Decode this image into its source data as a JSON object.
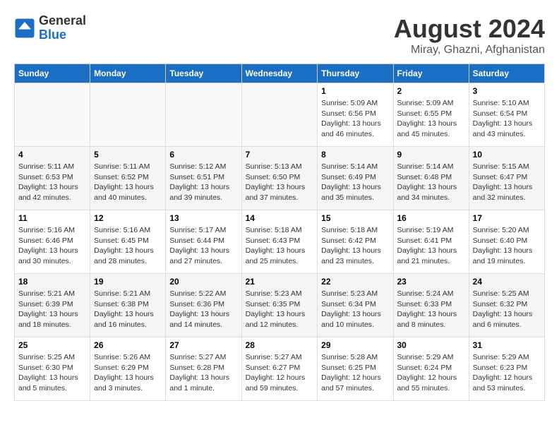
{
  "logo": {
    "general": "General",
    "blue": "Blue"
  },
  "title": "August 2024",
  "location": "Miray, Ghazni, Afghanistan",
  "days_of_week": [
    "Sunday",
    "Monday",
    "Tuesday",
    "Wednesday",
    "Thursday",
    "Friday",
    "Saturday"
  ],
  "weeks": [
    [
      {
        "date": "",
        "info": ""
      },
      {
        "date": "",
        "info": ""
      },
      {
        "date": "",
        "info": ""
      },
      {
        "date": "",
        "info": ""
      },
      {
        "date": "1",
        "info": "Sunrise: 5:09 AM\nSunset: 6:56 PM\nDaylight: 13 hours and 46 minutes."
      },
      {
        "date": "2",
        "info": "Sunrise: 5:09 AM\nSunset: 6:55 PM\nDaylight: 13 hours and 45 minutes."
      },
      {
        "date": "3",
        "info": "Sunrise: 5:10 AM\nSunset: 6:54 PM\nDaylight: 13 hours and 43 minutes."
      }
    ],
    [
      {
        "date": "4",
        "info": "Sunrise: 5:11 AM\nSunset: 6:53 PM\nDaylight: 13 hours and 42 minutes."
      },
      {
        "date": "5",
        "info": "Sunrise: 5:11 AM\nSunset: 6:52 PM\nDaylight: 13 hours and 40 minutes."
      },
      {
        "date": "6",
        "info": "Sunrise: 5:12 AM\nSunset: 6:51 PM\nDaylight: 13 hours and 39 minutes."
      },
      {
        "date": "7",
        "info": "Sunrise: 5:13 AM\nSunset: 6:50 PM\nDaylight: 13 hours and 37 minutes."
      },
      {
        "date": "8",
        "info": "Sunrise: 5:14 AM\nSunset: 6:49 PM\nDaylight: 13 hours and 35 minutes."
      },
      {
        "date": "9",
        "info": "Sunrise: 5:14 AM\nSunset: 6:48 PM\nDaylight: 13 hours and 34 minutes."
      },
      {
        "date": "10",
        "info": "Sunrise: 5:15 AM\nSunset: 6:47 PM\nDaylight: 13 hours and 32 minutes."
      }
    ],
    [
      {
        "date": "11",
        "info": "Sunrise: 5:16 AM\nSunset: 6:46 PM\nDaylight: 13 hours and 30 minutes."
      },
      {
        "date": "12",
        "info": "Sunrise: 5:16 AM\nSunset: 6:45 PM\nDaylight: 13 hours and 28 minutes."
      },
      {
        "date": "13",
        "info": "Sunrise: 5:17 AM\nSunset: 6:44 PM\nDaylight: 13 hours and 27 minutes."
      },
      {
        "date": "14",
        "info": "Sunrise: 5:18 AM\nSunset: 6:43 PM\nDaylight: 13 hours and 25 minutes."
      },
      {
        "date": "15",
        "info": "Sunrise: 5:18 AM\nSunset: 6:42 PM\nDaylight: 13 hours and 23 minutes."
      },
      {
        "date": "16",
        "info": "Sunrise: 5:19 AM\nSunset: 6:41 PM\nDaylight: 13 hours and 21 minutes."
      },
      {
        "date": "17",
        "info": "Sunrise: 5:20 AM\nSunset: 6:40 PM\nDaylight: 13 hours and 19 minutes."
      }
    ],
    [
      {
        "date": "18",
        "info": "Sunrise: 5:21 AM\nSunset: 6:39 PM\nDaylight: 13 hours and 18 minutes."
      },
      {
        "date": "19",
        "info": "Sunrise: 5:21 AM\nSunset: 6:38 PM\nDaylight: 13 hours and 16 minutes."
      },
      {
        "date": "20",
        "info": "Sunrise: 5:22 AM\nSunset: 6:36 PM\nDaylight: 13 hours and 14 minutes."
      },
      {
        "date": "21",
        "info": "Sunrise: 5:23 AM\nSunset: 6:35 PM\nDaylight: 13 hours and 12 minutes."
      },
      {
        "date": "22",
        "info": "Sunrise: 5:23 AM\nSunset: 6:34 PM\nDaylight: 13 hours and 10 minutes."
      },
      {
        "date": "23",
        "info": "Sunrise: 5:24 AM\nSunset: 6:33 PM\nDaylight: 13 hours and 8 minutes."
      },
      {
        "date": "24",
        "info": "Sunrise: 5:25 AM\nSunset: 6:32 PM\nDaylight: 13 hours and 6 minutes."
      }
    ],
    [
      {
        "date": "25",
        "info": "Sunrise: 5:25 AM\nSunset: 6:30 PM\nDaylight: 13 hours and 5 minutes."
      },
      {
        "date": "26",
        "info": "Sunrise: 5:26 AM\nSunset: 6:29 PM\nDaylight: 13 hours and 3 minutes."
      },
      {
        "date": "27",
        "info": "Sunrise: 5:27 AM\nSunset: 6:28 PM\nDaylight: 13 hours and 1 minute."
      },
      {
        "date": "28",
        "info": "Sunrise: 5:27 AM\nSunset: 6:27 PM\nDaylight: 12 hours and 59 minutes."
      },
      {
        "date": "29",
        "info": "Sunrise: 5:28 AM\nSunset: 6:25 PM\nDaylight: 12 hours and 57 minutes."
      },
      {
        "date": "30",
        "info": "Sunrise: 5:29 AM\nSunset: 6:24 PM\nDaylight: 12 hours and 55 minutes."
      },
      {
        "date": "31",
        "info": "Sunrise: 5:29 AM\nSunset: 6:23 PM\nDaylight: 12 hours and 53 minutes."
      }
    ]
  ]
}
